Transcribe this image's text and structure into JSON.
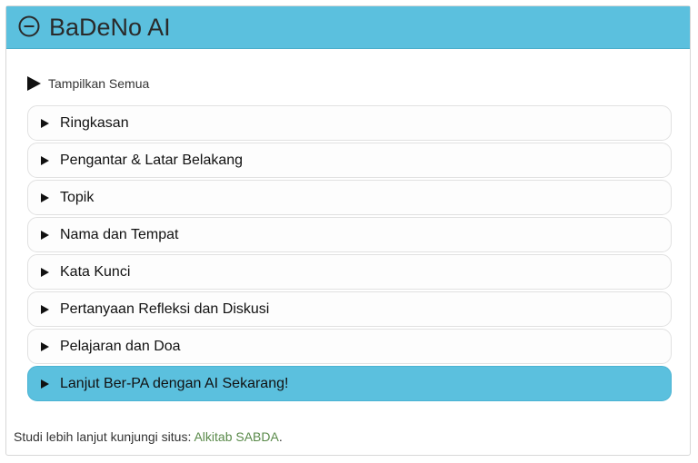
{
  "header": {
    "title": "BaDeNo AI",
    "icon": "circle-minus-icon",
    "background_color": "#5bc0de"
  },
  "show_all": {
    "label": "Tampilkan Semua",
    "icon": "play-arrow-icon"
  },
  "accordion": {
    "items": [
      {
        "label": "Ringkasan",
        "active": false
      },
      {
        "label": "Pengantar & Latar Belakang",
        "active": false
      },
      {
        "label": "Topik",
        "active": false
      },
      {
        "label": "Nama dan Tempat",
        "active": false
      },
      {
        "label": "Kata Kunci",
        "active": false
      },
      {
        "label": "Pertanyaan Refleksi dan Diskusi",
        "active": false
      },
      {
        "label": "Pelajaran dan Doa",
        "active": false
      },
      {
        "label": "Lanjut Ber-PA dengan AI Sekarang!",
        "active": true
      }
    ],
    "active_color": "#5bc0de"
  },
  "footer": {
    "text": "Studi lebih lanjut kunjungi situs: ",
    "link_label": "Alkitab SABDA",
    "suffix": ".",
    "link_color": "#5a8a4a"
  }
}
